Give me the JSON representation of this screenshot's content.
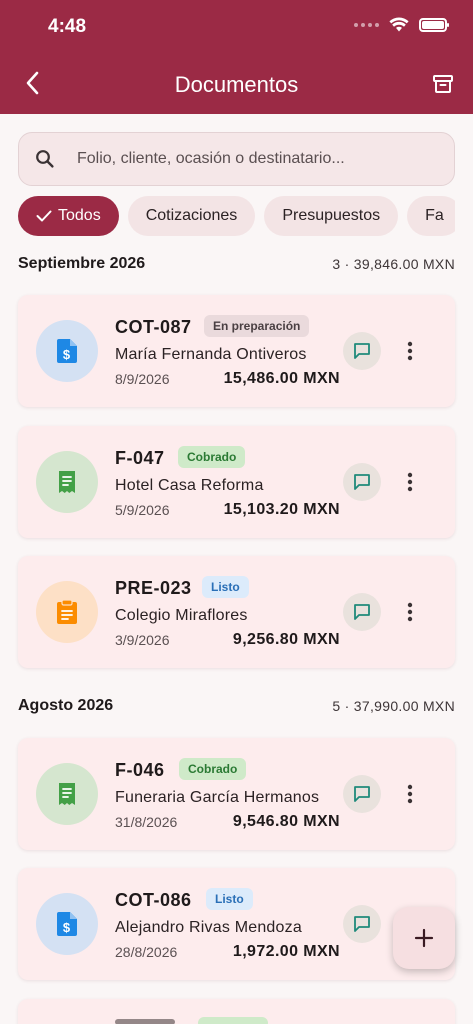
{
  "status_bar": {
    "time": "4:48"
  },
  "header": {
    "title": "Documentos"
  },
  "search": {
    "placeholder": "Folio, cliente, ocasión o destinatario..."
  },
  "filters": [
    {
      "label": "Todos",
      "active": true
    },
    {
      "label": "Cotizaciones",
      "active": false
    },
    {
      "label": "Presupuestos",
      "active": false
    },
    {
      "label": "Fa",
      "active": false
    }
  ],
  "sections": [
    {
      "title": "Septiembre 2026",
      "summary": "3 · 39,846.00 MXN",
      "items": [
        {
          "id": "COT-087",
          "status": "En preparación",
          "client": "María Fernanda Ontiveros",
          "date": "8/9/2026",
          "amount": "15,486.00 MXN",
          "icon": "dollar-document-icon"
        },
        {
          "id": "F-047",
          "status": "Cobrado",
          "client": "Hotel Casa Reforma",
          "date": "5/9/2026",
          "amount": "15,103.20 MXN",
          "icon": "receipt-icon"
        },
        {
          "id": "PRE-023",
          "status": "Listo",
          "client": "Colegio Miraflores",
          "date": "3/9/2026",
          "amount": "9,256.80 MXN",
          "icon": "clipboard-icon"
        }
      ]
    },
    {
      "title": "Agosto 2026",
      "summary": "5 · 37,990.00 MXN",
      "items": [
        {
          "id": "F-046",
          "status": "Cobrado",
          "client": "Funeraria García Hermanos",
          "date": "31/8/2026",
          "amount": "9,546.80 MXN",
          "icon": "receipt-icon"
        },
        {
          "id": "COT-086",
          "status": "Listo",
          "client": "Alejandro Rivas Mendoza",
          "date": "28/8/2026",
          "amount": "1,972.00 MXN",
          "icon": "dollar-document-icon"
        }
      ]
    }
  ],
  "fab": {
    "label": "+"
  },
  "colors": {
    "primary": "#9b2a45",
    "card": "#fdeced",
    "cobrado": "#2b7a34",
    "listo": "#2a6fb7"
  }
}
